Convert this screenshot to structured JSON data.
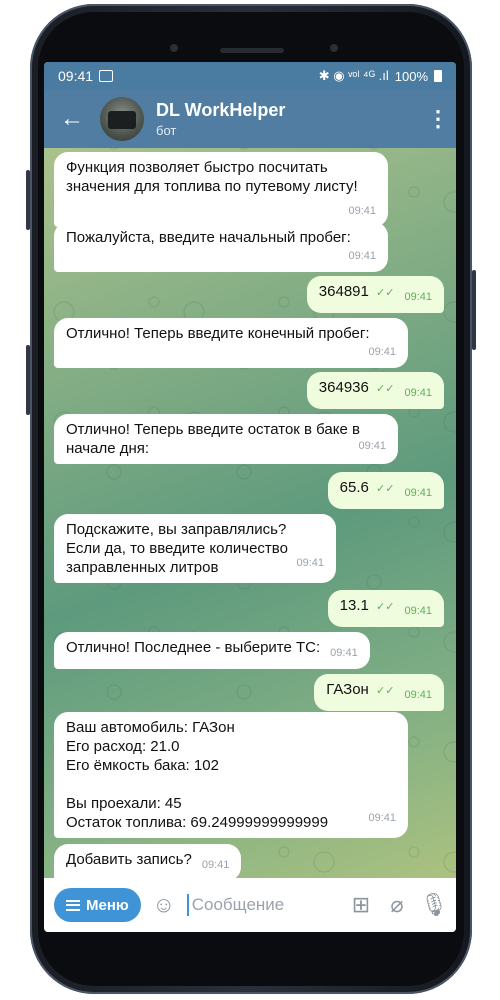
{
  "status": {
    "time": "09:41",
    "indicators": "✱ ◉ ᵛᵒˡ ⁴ᴳ .ıl",
    "battery": "100%"
  },
  "chat": {
    "title": "DL WorkHelper",
    "subtitle": "бот"
  },
  "messages": [
    {
      "dir": "in",
      "text": "Функция позволяет быстро посчитать\nзначения для топлива по путевому листу!",
      "time": "09:41"
    },
    {
      "dir": "in",
      "text": "Пожалуйста, введите начальный пробег:",
      "time": "09:41"
    },
    {
      "dir": "out",
      "text": "364891",
      "time": "09:41"
    },
    {
      "dir": "in",
      "text": "Отлично! Теперь введите конечный пробег:",
      "time": "09:41"
    },
    {
      "dir": "out",
      "text": "364936",
      "time": "09:41"
    },
    {
      "dir": "in",
      "text": "Отлично! Теперь введите остаток в баке в\nначале дня:",
      "time": "09:41"
    },
    {
      "dir": "out",
      "text": "65.6",
      "time": "09:41"
    },
    {
      "dir": "in",
      "text": "Подскажите, вы заправлялись?\nЕсли да, то введите количество\nзаправленных литров",
      "time": "09:41"
    },
    {
      "dir": "out",
      "text": "13.1",
      "time": "09:41"
    },
    {
      "dir": "in",
      "text": "Отлично! Последнее - выберите ТС:",
      "time": "09:41"
    },
    {
      "dir": "out",
      "text": "ГАЗон",
      "time": "09:41"
    },
    {
      "dir": "in",
      "text": "Ваш автомобиль: ГАЗон\nЕго расход: 21.0\nЕго ёмкость бака: 102\n\nВы проехали: 45\nОстаток топлива: 69.24999999999999",
      "time": "09:41"
    },
    {
      "dir": "in",
      "text": "Добавить запись?",
      "time": "09:41"
    }
  ],
  "input": {
    "menu_label": "Меню",
    "placeholder": "Сообщение"
  },
  "icons": {
    "back": "back-arrow-icon",
    "more": "more-vertical-icon",
    "emoji": "emoji-icon",
    "keyboard": "bot-keyboard-icon",
    "attach": "attach-icon",
    "mic": "mic-icon"
  },
  "colors": {
    "header": "#517da2",
    "statusbar": "#4a7ba0",
    "outgoing": "#effdde",
    "incoming": "#ffffff",
    "accent": "#3f94d8"
  }
}
